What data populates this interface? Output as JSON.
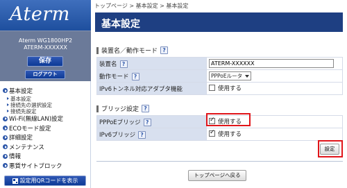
{
  "brand": {
    "logo": "Aterm"
  },
  "device": {
    "model": "Aterm WG1800HP2",
    "name": "ATERM-XXXXXX"
  },
  "sidebar": {
    "save_label": "保存",
    "logout_label": "ログアウト",
    "items": [
      {
        "label": "基本設定",
        "subs": [
          "基本設定",
          "接続先の選択設定",
          "接続先設定"
        ]
      },
      {
        "label": "Wi-Fi(無線LAN)設定"
      },
      {
        "label": "ECOモード設定"
      },
      {
        "label": "詳細設定"
      },
      {
        "label": "メンテナンス"
      },
      {
        "label": "情報"
      },
      {
        "label": "悪質サイトブロック"
      }
    ],
    "qr_label": "設定用QRコードを表示"
  },
  "breadcrumb": "トップページ > 基本設定 > 基本設定",
  "page_title": "基本設定",
  "section1": {
    "title": "装置名／動作モード",
    "help": "?",
    "rows": {
      "device_name": {
        "label": "装置名",
        "value": "ATERM-XXXXXX"
      },
      "mode": {
        "label": "動作モード",
        "value": "PPPoEルータ"
      },
      "ipv6_tunnel": {
        "label": "IPv6トンネル対応アダプタ機能",
        "option": "使用する",
        "checked": false
      }
    }
  },
  "section2": {
    "title": "ブリッジ設定",
    "help": "?",
    "rows": {
      "pppoe_bridge": {
        "label": "PPPoEブリッジ",
        "option": "使用する",
        "checked": true
      },
      "ipv6_bridge": {
        "label": "IPv6ブリッジ",
        "option": "使用する",
        "checked": true
      }
    }
  },
  "buttons": {
    "settings": "設定",
    "back": "トップページへ戻る"
  },
  "colors": {
    "header": "#1e3f82",
    "highlight": "#e0151a",
    "label_bg": "#d8e0ef"
  }
}
